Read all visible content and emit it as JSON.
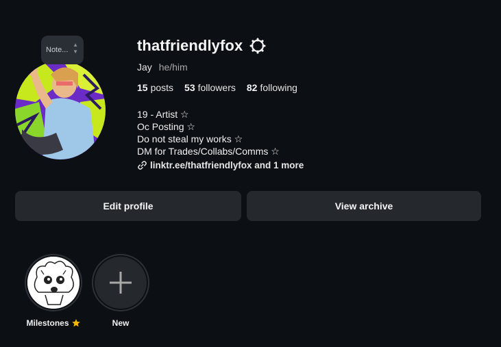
{
  "profile": {
    "username": "thatfriendlyfox",
    "name": "Jay",
    "pronouns": "he/him",
    "note_label": "Note...",
    "stats": [
      {
        "count": "15",
        "label": "posts"
      },
      {
        "count": "53",
        "label": "followers"
      },
      {
        "count": "82",
        "label": "following"
      }
    ],
    "bio": [
      "19 - Artist ☆",
      "Oc Posting ☆",
      "Do not steal my works ☆",
      "DM for Trades/Collabs/Comms ☆"
    ],
    "link_text": "linktr.ee/thatfriendlyfox and 1 more"
  },
  "actions": {
    "edit_label": "Edit profile",
    "archive_label": "View archive"
  },
  "highlights": [
    {
      "label": "Milestones",
      "icon": "star-emoji-icon"
    },
    {
      "label": "New",
      "icon": "plus-icon"
    }
  ],
  "icons": {
    "settings": "gear-icon",
    "link": "link-icon",
    "note_arrows": "chevron-up-down-icon"
  },
  "colors": {
    "background": "#0c1014",
    "button": "#25292e",
    "text": "#f5f5f5",
    "muted": "#a8a8a8",
    "star": "#f5b800"
  }
}
